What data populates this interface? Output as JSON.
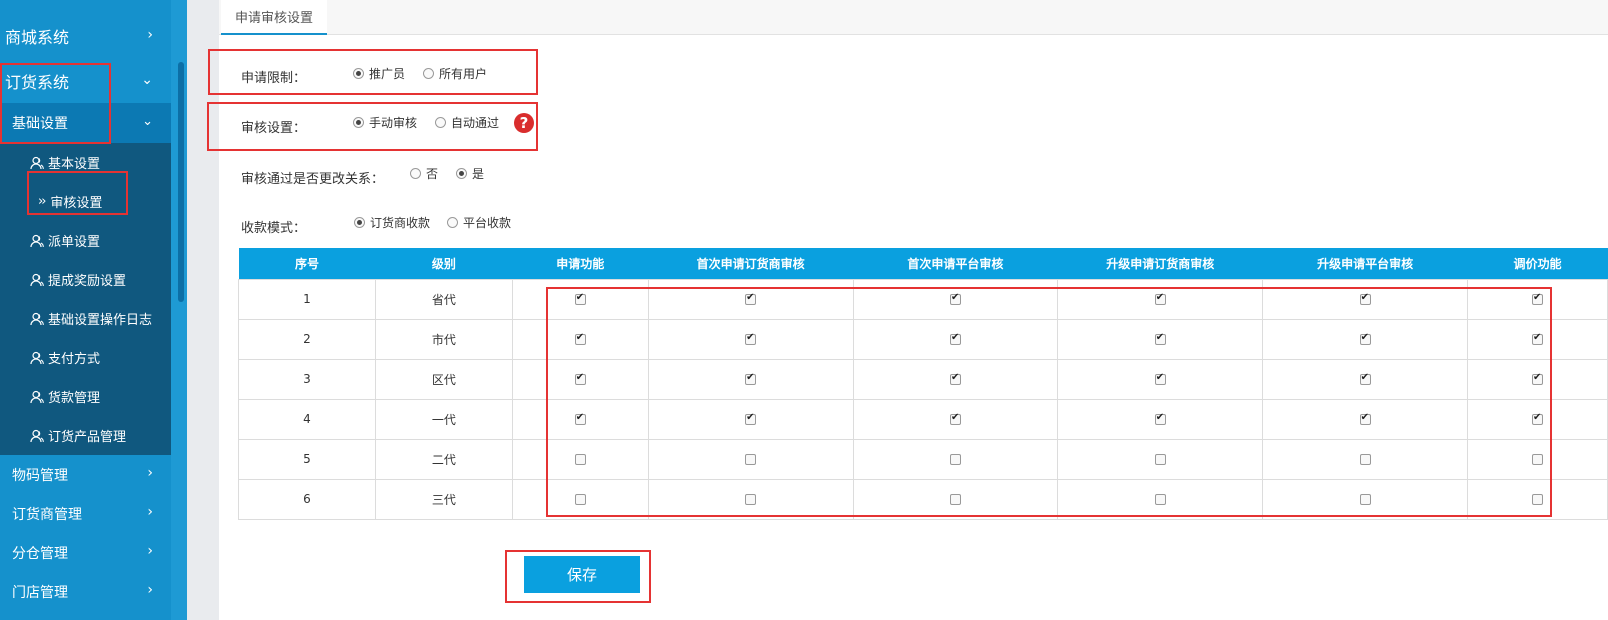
{
  "sidebar": {
    "top_items": [
      {
        "label": "商城系统",
        "icon": "chevron-right-icon"
      },
      {
        "label": "订货系统",
        "icon": "chevron-down-icon"
      }
    ],
    "sub_header": {
      "label": "基础设置",
      "icon": "chevron-down-icon"
    },
    "sub_items": [
      {
        "label": "基本设置",
        "icon": "user-icon"
      },
      {
        "label": "审核设置",
        "icon": "double-chevron-right-icon",
        "active": true
      },
      {
        "label": "派单设置",
        "icon": "user-icon"
      },
      {
        "label": "提成奖励设置",
        "icon": "user-icon"
      },
      {
        "label": "基础设置操作日志",
        "icon": "user-icon"
      },
      {
        "label": "支付方式",
        "icon": "user-icon"
      },
      {
        "label": "货款管理",
        "icon": "user-icon"
      },
      {
        "label": "订货产品管理",
        "icon": "user-icon"
      }
    ],
    "sections": [
      {
        "label": "物码管理"
      },
      {
        "label": "订货商管理"
      },
      {
        "label": "分仓管理"
      },
      {
        "label": "门店管理"
      }
    ]
  },
  "tab": {
    "label": "申请审核设置"
  },
  "form": {
    "apply_limit": {
      "label": "申请限制：",
      "options": [
        "推广员",
        "所有用户"
      ],
      "selected": 0
    },
    "review": {
      "label": "审核设置：",
      "options": [
        "手动审核",
        "自动通过"
      ],
      "selected": 0,
      "help": "?"
    },
    "change_relation": {
      "label": "审核通过是否更改关系：",
      "options": [
        "否",
        "是"
      ],
      "selected": 1
    },
    "payment_mode": {
      "label": "收款模式：",
      "options": [
        "订货商收款",
        "平台收款"
      ],
      "selected": 0
    }
  },
  "table": {
    "headers": [
      "序号",
      "级别",
      "申请功能",
      "首次申请订货商审核",
      "首次申请平台审核",
      "升级申请订货商审核",
      "升级申请平台审核",
      "调价功能"
    ],
    "rows": [
      {
        "no": "1",
        "level": "省代",
        "checks": [
          true,
          true,
          true,
          true,
          true,
          true
        ]
      },
      {
        "no": "2",
        "level": "市代",
        "checks": [
          true,
          true,
          true,
          true,
          true,
          true
        ]
      },
      {
        "no": "3",
        "level": "区代",
        "checks": [
          true,
          true,
          true,
          true,
          true,
          true
        ]
      },
      {
        "no": "4",
        "level": "一代",
        "checks": [
          true,
          true,
          true,
          true,
          true,
          true
        ]
      },
      {
        "no": "5",
        "level": "二代",
        "checks": [
          false,
          false,
          false,
          false,
          false,
          false
        ]
      },
      {
        "no": "6",
        "level": "三代",
        "checks": [
          false,
          false,
          false,
          false,
          false,
          false
        ]
      }
    ]
  },
  "save_label": "保存",
  "colors": {
    "sidebar": "#1591cc",
    "subpanel": "#10587f",
    "accent": "#0aa0df",
    "highlight": "#e53333"
  }
}
